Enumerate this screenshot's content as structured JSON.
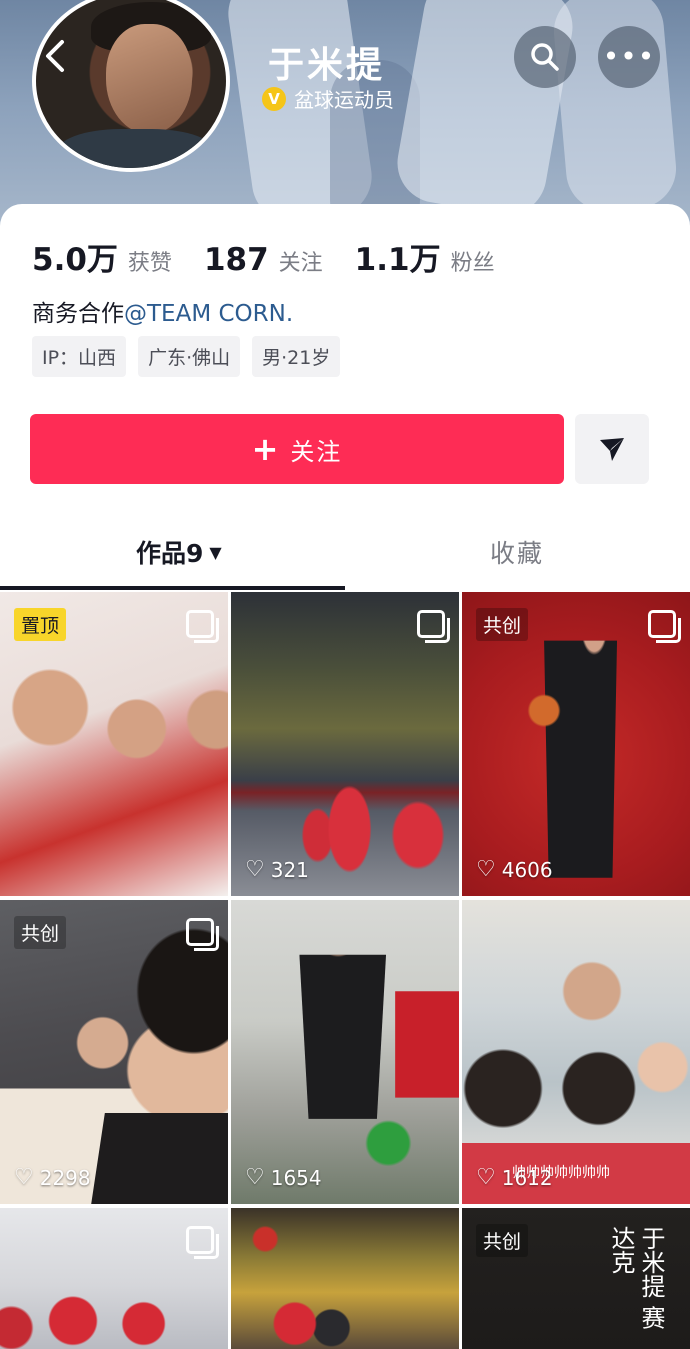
{
  "profile": {
    "name": "于米提",
    "verify_text": "盆球运动员",
    "verify_badge": "V",
    "accent_color": "#fe2c55"
  },
  "nav": {
    "back_icon": "chevron-left-icon",
    "search_icon": "search-icon",
    "more_icon": "more-icon",
    "more_glyph": "•••"
  },
  "stats": [
    {
      "value": "5.0万",
      "label": "获赞"
    },
    {
      "value": "187",
      "label": "关注"
    },
    {
      "value": "1.1万",
      "label": "粉丝"
    }
  ],
  "bio": {
    "prefix": "商务合作",
    "mention": "@TEAM CORN."
  },
  "tags": [
    "IP：山西",
    "广东·佛山",
    "男·21岁"
  ],
  "actions": {
    "follow_plus": "+",
    "follow_label": "关注",
    "share_icon": "send-icon"
  },
  "tabs": {
    "works_label": "作品9",
    "works_caret": "▼",
    "favorites_label": "收藏"
  },
  "videos": [
    {
      "badge": "置顶",
      "badge_type": "pin",
      "multi": true,
      "likes": ""
    },
    {
      "badge": "",
      "badge_type": "",
      "multi": true,
      "likes": "321"
    },
    {
      "badge": "共创",
      "badge_type": "co",
      "multi": true,
      "likes": "4606"
    },
    {
      "badge": "共创",
      "badge_type": "co",
      "multi": true,
      "likes": "2298"
    },
    {
      "badge": "",
      "badge_type": "",
      "multi": false,
      "likes": "1654"
    },
    {
      "badge": "",
      "badge_type": "",
      "multi": false,
      "likes": "1612",
      "caption": "帅帅帅帅帅帅帅"
    },
    {
      "badge": "",
      "badge_type": "",
      "multi": true,
      "likes": ""
    },
    {
      "badge": "",
      "badge_type": "",
      "multi": false,
      "likes": ""
    },
    {
      "badge": "共创",
      "badge_type": "co",
      "multi": false,
      "likes": "",
      "poster_text": "于米提 赛达克"
    }
  ]
}
